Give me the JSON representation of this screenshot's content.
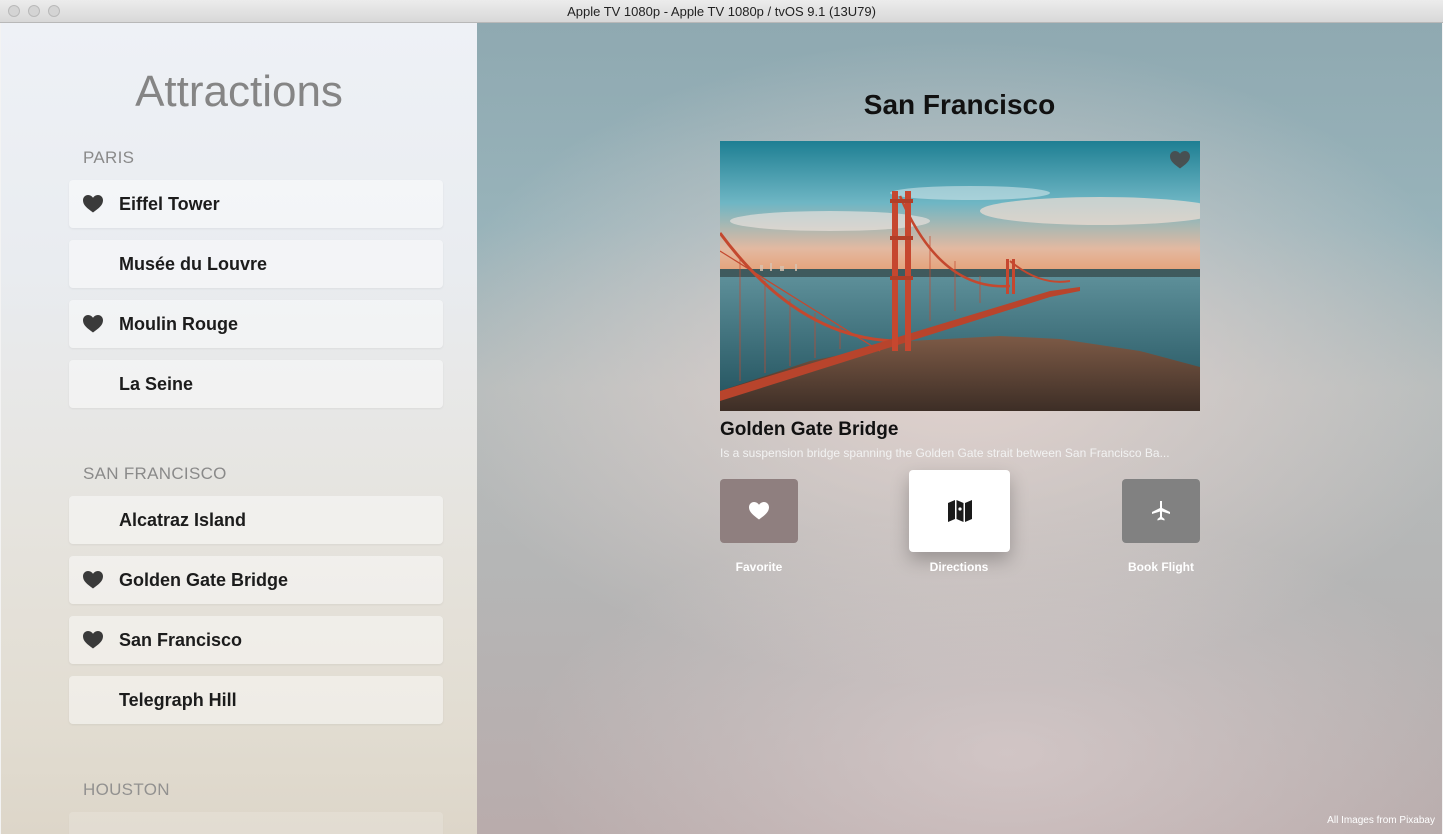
{
  "window": {
    "title": "Apple TV 1080p - Apple TV 1080p / tvOS 9.1 (13U79)"
  },
  "sidebar": {
    "title": "Attractions",
    "sections": [
      {
        "header": "PARIS",
        "items": [
          {
            "label": "Eiffel Tower",
            "favorite": true
          },
          {
            "label": "Musée du Louvre",
            "favorite": false
          },
          {
            "label": "Moulin Rouge",
            "favorite": true
          },
          {
            "label": "La Seine",
            "favorite": false
          }
        ]
      },
      {
        "header": "SAN FRANCISCO",
        "items": [
          {
            "label": "Alcatraz Island",
            "favorite": false
          },
          {
            "label": "Golden Gate Bridge",
            "favorite": true
          },
          {
            "label": "San Francisco",
            "favorite": true
          },
          {
            "label": "Telegraph Hill",
            "favorite": false
          }
        ]
      },
      {
        "header": "HOUSTON",
        "items": []
      }
    ]
  },
  "detail": {
    "city": "San Francisco",
    "photo_icon": "heart-icon",
    "item_title": "Golden Gate Bridge",
    "item_description": "Is a suspension bridge spanning the Golden Gate strait between San Francisco Ba...",
    "actions": [
      {
        "label": "Favorite",
        "icon": "heart-icon",
        "focused": false,
        "color": "#8f7f7f"
      },
      {
        "label": "Directions",
        "icon": "map-icon",
        "focused": true,
        "color": "#ffffff"
      },
      {
        "label": "Book Flight",
        "icon": "airplane-icon",
        "focused": false,
        "color": "#818181"
      }
    ]
  },
  "footer": {
    "credit": "All Images from Pixabay"
  }
}
